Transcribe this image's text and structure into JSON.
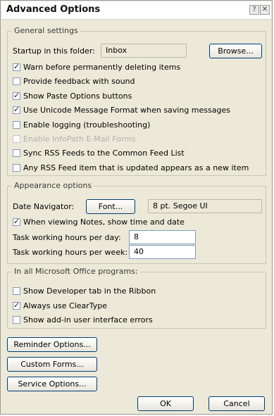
{
  "window": {
    "title": "Advanced Options",
    "help_glyph": "?",
    "close_glyph": "✕"
  },
  "general": {
    "label": "General settings",
    "startup_label": "Startup in this folder:",
    "startup_value": "Inbox",
    "browse": "Browse...",
    "options": [
      {
        "label": "Warn before permanently deleting items",
        "checked": true,
        "enabled": true
      },
      {
        "label": "Provide feedback with sound",
        "checked": false,
        "enabled": true
      },
      {
        "label": "Show Paste Options buttons",
        "checked": true,
        "enabled": true
      },
      {
        "label": "Use Unicode Message Format when saving messages",
        "checked": true,
        "enabled": true
      },
      {
        "label": "Enable logging (troubleshooting)",
        "checked": false,
        "enabled": true
      },
      {
        "label": "Enable InfoPath E-Mail Forms",
        "checked": false,
        "enabled": false
      },
      {
        "label": "Sync RSS Feeds to the Common Feed List",
        "checked": false,
        "enabled": true
      },
      {
        "label": "Any RSS Feed item that is updated appears as a new item",
        "checked": false,
        "enabled": true
      }
    ]
  },
  "appearance": {
    "label": "Appearance options",
    "date_nav_label": "Date Navigator:",
    "font_button": "Font...",
    "font_value": "8 pt. Segoe UI",
    "notes_option": {
      "label": "When viewing Notes, show time and date",
      "checked": true
    },
    "hours_day_label": "Task working hours per day:",
    "hours_day_value": "8",
    "hours_week_label": "Task working hours per week:",
    "hours_week_value": "40"
  },
  "office": {
    "label": "In all Microsoft Office programs:",
    "options": [
      {
        "label": "Show Developer tab in the Ribbon",
        "checked": false
      },
      {
        "label": "Always use ClearType",
        "checked": true
      },
      {
        "label": "Show add-in user interface errors",
        "checked": false
      }
    ]
  },
  "buttons": {
    "reminder": "Reminder Options...",
    "custom_forms": "Custom Forms...",
    "service": "Service Options...",
    "ok": "OK",
    "cancel": "Cancel"
  }
}
